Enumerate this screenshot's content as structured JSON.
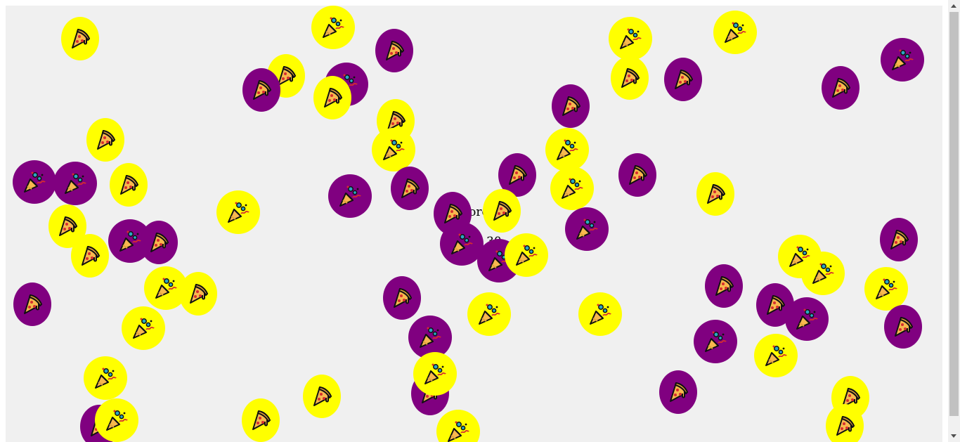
{
  "hud": {
    "score_text": "Score",
    "timer_text": "30"
  },
  "colors": {
    "purple": "#800080",
    "yellow": "#ffff00",
    "background": "#f0f0f0"
  },
  "tokens": [
    {
      "icon": "pizza-icon",
      "color": "yellow"
    },
    {
      "icon": "party-popper-icon",
      "color": "yellow"
    },
    {
      "icon": "pizza-icon",
      "color": "purple"
    },
    {
      "icon": "pizza-icon",
      "color": "yellow"
    },
    {
      "icon": "party-popper-icon",
      "color": "purple"
    },
    {
      "icon": "pizza-icon",
      "color": "purple"
    },
    {
      "icon": "pizza-icon",
      "color": "yellow"
    },
    {
      "icon": "party-popper-icon",
      "color": "yellow"
    },
    {
      "icon": "party-popper-icon",
      "color": "yellow"
    },
    {
      "icon": "party-popper-icon",
      "color": "purple"
    },
    {
      "icon": "pizza-icon",
      "color": "purple"
    },
    {
      "icon": "pizza-icon",
      "color": "yellow"
    },
    {
      "icon": "pizza-icon",
      "color": "purple"
    },
    {
      "icon": "pizza-icon",
      "color": "yellow"
    },
    {
      "icon": "pizza-icon",
      "color": "yellow"
    },
    {
      "icon": "party-popper-icon",
      "color": "yellow"
    },
    {
      "icon": "party-popper-icon",
      "color": "yellow"
    },
    {
      "icon": "pizza-icon",
      "color": "purple"
    },
    {
      "icon": "party-popper-icon",
      "color": "purple"
    },
    {
      "icon": "party-popper-icon",
      "color": "purple"
    },
    {
      "icon": "pizza-icon",
      "color": "yellow"
    },
    {
      "icon": "pizza-icon",
      "color": "purple"
    },
    {
      "icon": "party-popper-icon",
      "color": "purple"
    },
    {
      "icon": "pizza-icon",
      "color": "purple"
    },
    {
      "icon": "party-popper-icon",
      "color": "yellow"
    },
    {
      "icon": "pizza-icon",
      "color": "purple"
    },
    {
      "icon": "pizza-icon",
      "color": "yellow"
    },
    {
      "icon": "party-popper-icon",
      "color": "yellow"
    },
    {
      "icon": "pizza-icon",
      "color": "yellow"
    },
    {
      "icon": "pizza-icon",
      "color": "yellow"
    },
    {
      "icon": "pizza-icon",
      "color": "purple"
    },
    {
      "icon": "party-popper-icon",
      "color": "purple"
    },
    {
      "icon": "pizza-icon",
      "color": "purple"
    },
    {
      "icon": "party-popper-icon",
      "color": "purple"
    },
    {
      "icon": "party-popper-icon",
      "color": "purple"
    },
    {
      "icon": "pizza-icon",
      "color": "yellow"
    },
    {
      "icon": "party-popper-icon",
      "color": "purple"
    },
    {
      "icon": "party-popper-icon",
      "color": "yellow"
    },
    {
      "icon": "pizza-icon",
      "color": "purple"
    },
    {
      "icon": "party-popper-icon",
      "color": "yellow"
    },
    {
      "icon": "pizza-icon",
      "color": "yellow"
    },
    {
      "icon": "pizza-icon",
      "color": "purple"
    },
    {
      "icon": "party-popper-icon",
      "color": "yellow"
    },
    {
      "icon": "party-popper-icon",
      "color": "yellow"
    },
    {
      "icon": "pizza-icon",
      "color": "purple"
    },
    {
      "icon": "party-popper-icon",
      "color": "yellow"
    },
    {
      "icon": "pizza-icon",
      "color": "purple"
    },
    {
      "icon": "pizza-icon",
      "color": "purple"
    },
    {
      "icon": "party-popper-icon",
      "color": "purple"
    },
    {
      "icon": "pizza-icon",
      "color": "purple"
    },
    {
      "icon": "party-popper-icon",
      "color": "purple"
    },
    {
      "icon": "party-popper-icon",
      "color": "yellow"
    },
    {
      "icon": "party-popper-icon",
      "color": "yellow"
    },
    {
      "icon": "party-popper-icon",
      "color": "purple"
    },
    {
      "icon": "pizza-icon",
      "color": "purple"
    },
    {
      "icon": "party-popper-icon",
      "color": "yellow"
    },
    {
      "icon": "pizza-icon",
      "color": "yellow"
    },
    {
      "icon": "pizza-icon",
      "color": "purple"
    },
    {
      "icon": "party-popper-icon",
      "color": "yellow"
    },
    {
      "icon": "pizza-icon",
      "color": "yellow"
    },
    {
      "icon": "party-popper-icon",
      "color": "yellow"
    },
    {
      "icon": "party-popper-icon",
      "color": "yellow"
    },
    {
      "icon": "pizza-icon",
      "color": "purple"
    },
    {
      "icon": "party-popper-icon",
      "color": "yellow"
    },
    {
      "icon": "pizza-icon",
      "color": "yellow"
    },
    {
      "icon": "party-popper-icon",
      "color": "yellow"
    },
    {
      "icon": "pizza-icon",
      "color": "yellow"
    }
  ]
}
